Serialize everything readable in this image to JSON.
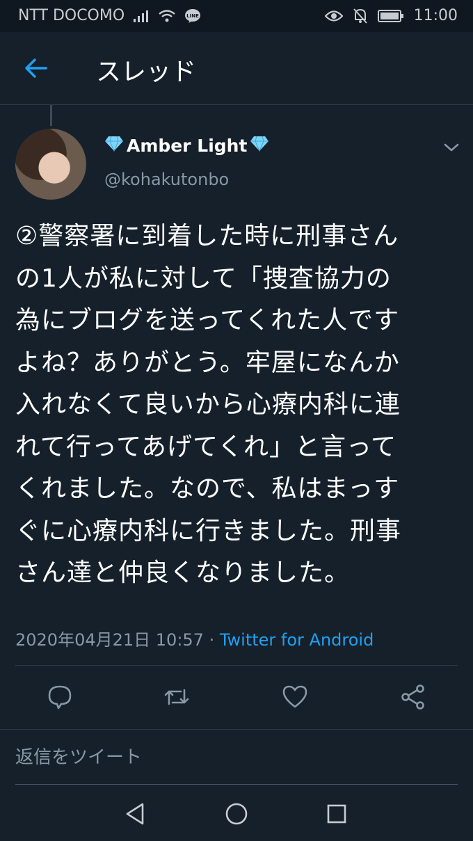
{
  "status_bar": {
    "carrier": "NTT DOCOMO",
    "time": "11:00"
  },
  "header": {
    "title": "スレッド"
  },
  "tweet": {
    "display_name": "Amber Light",
    "handle": "@kohakutonbo",
    "text_lines": [
      "②警察署に到着した時に刑事さん",
      "の1人が私に対して「捜査協力の",
      "為にブログを送ってくれた人です",
      "よね？ありがとう。牢屋になんか",
      "入れなくて良いから心療内科に連",
      "れて行ってあげてくれ」と言って",
      "くれました。なので、私はまっす",
      "ぐに心療内科に行きました。刑事",
      "さん達と仲良くなりました。"
    ],
    "timestamp": "2020年04月21日 10:57",
    "separator": " · ",
    "source": "Twitter for Android"
  },
  "reply": {
    "placeholder": "返信をツイート"
  },
  "colors": {
    "background": "#15202b",
    "accent": "#1da1f2",
    "secondary_text": "#8899a6"
  },
  "icons": [
    "back-arrow-icon",
    "chevron-down-icon",
    "reply-icon",
    "retweet-icon",
    "like-icon",
    "share-icon",
    "nav-back-icon",
    "nav-home-icon",
    "nav-recents-icon",
    "diamond-icon"
  ]
}
